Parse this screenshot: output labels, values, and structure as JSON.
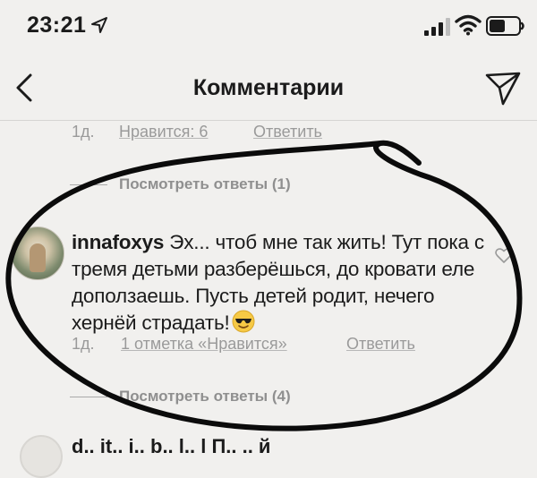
{
  "status_bar": {
    "time": "23:21",
    "icons": [
      "location-arrow-icon",
      "cellular-signal-icon",
      "wifi-icon",
      "battery-icon"
    ]
  },
  "nav": {
    "title": "Комментарии",
    "back_icon": "chevron-left-icon",
    "send_icon": "paper-plane-icon"
  },
  "previous_comment": {
    "time": "1д.",
    "likes": "Нравится: 6",
    "reply": "Ответить",
    "view_replies": "Посмотреть ответы (1)"
  },
  "comment": {
    "username": "innafoxys",
    "text": " Эх... чтоб мне так жить! Тут пока с тремя детьми разберёшься, до кровати еле доползаешь. Пусть детей родит, нечего хернёй страдать!",
    "emoji": "smiling-face-with-sunglasses",
    "time": "1д.",
    "likes": "1 отметка «Нравится»",
    "reply": "Ответить",
    "view_replies": "Посмотреть ответы (4)"
  },
  "next_comment": {
    "partial_text": "d.. it.. i.. b.. l.. l  П.. .. й"
  },
  "colors": {
    "background": "#f1f0ee",
    "text": "#1b1b1b",
    "secondary": "#9a9a9a",
    "marker_ink": "#0b0b0b"
  }
}
